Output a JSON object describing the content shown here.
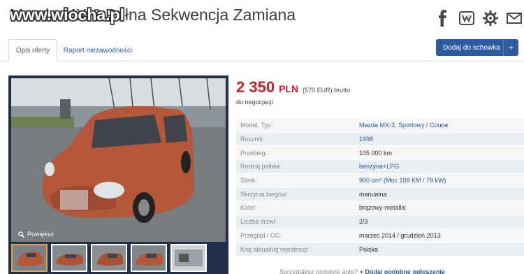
{
  "header": {
    "title": "Mazda MX-3 Pełna Sekwencja Zamiana",
    "watermark": "www.wiocha.pl"
  },
  "share": {
    "icons": [
      "facebook-icon",
      "wykop-icon",
      "settings-icon",
      "mail-icon"
    ]
  },
  "tabs": [
    {
      "label": "Opis oferty",
      "active": true
    },
    {
      "label": "Raport niezawodności",
      "active": false
    }
  ],
  "clipboard": {
    "label": "Dodaj do schowka",
    "plus": "+"
  },
  "gallery": {
    "zoom_label": "Powiększ"
  },
  "price": {
    "amount": "2 350",
    "currency": "PLN",
    "eur": "(570 EUR) brutto",
    "negotiable": "do negocjacji"
  },
  "specs": [
    {
      "label": "Model, Typ:",
      "value": "Mazda MX-3, Sportowy / Coupe",
      "link": true
    },
    {
      "label": "Rocznik:",
      "value": "1998",
      "link": true
    },
    {
      "label": "Przebieg:",
      "value": "105 000 km",
      "link": false
    },
    {
      "label": "Rodzaj paliwa:",
      "value": "benzyna+LPG",
      "link": true
    },
    {
      "label": "Silnik:",
      "value": "900 cm³  (Moc 108 KM / 79 kW)",
      "link": true
    },
    {
      "label": "Skrzynia biegów:",
      "value": "manualna",
      "link": false
    },
    {
      "label": "Kolor:",
      "value": "brązowy-metallic",
      "link": false
    },
    {
      "label": "Liczba drzwi:",
      "value": "2/3",
      "link": false
    },
    {
      "label": "Przegląd  /  OC:",
      "value": "marzec 2014 / grudzień 2013",
      "link": false
    },
    {
      "label": "Kraj aktualnej rejestracji:",
      "value": "Polska",
      "link": false
    }
  ],
  "bottom": {
    "text": "Sprzedajesz podobne auto?",
    "link": "+ Dodaj podobne ogłoszenie"
  },
  "colors": {
    "accent": "#2e5aa0",
    "price": "#c8202a",
    "gallery_bg": "#21304a"
  }
}
